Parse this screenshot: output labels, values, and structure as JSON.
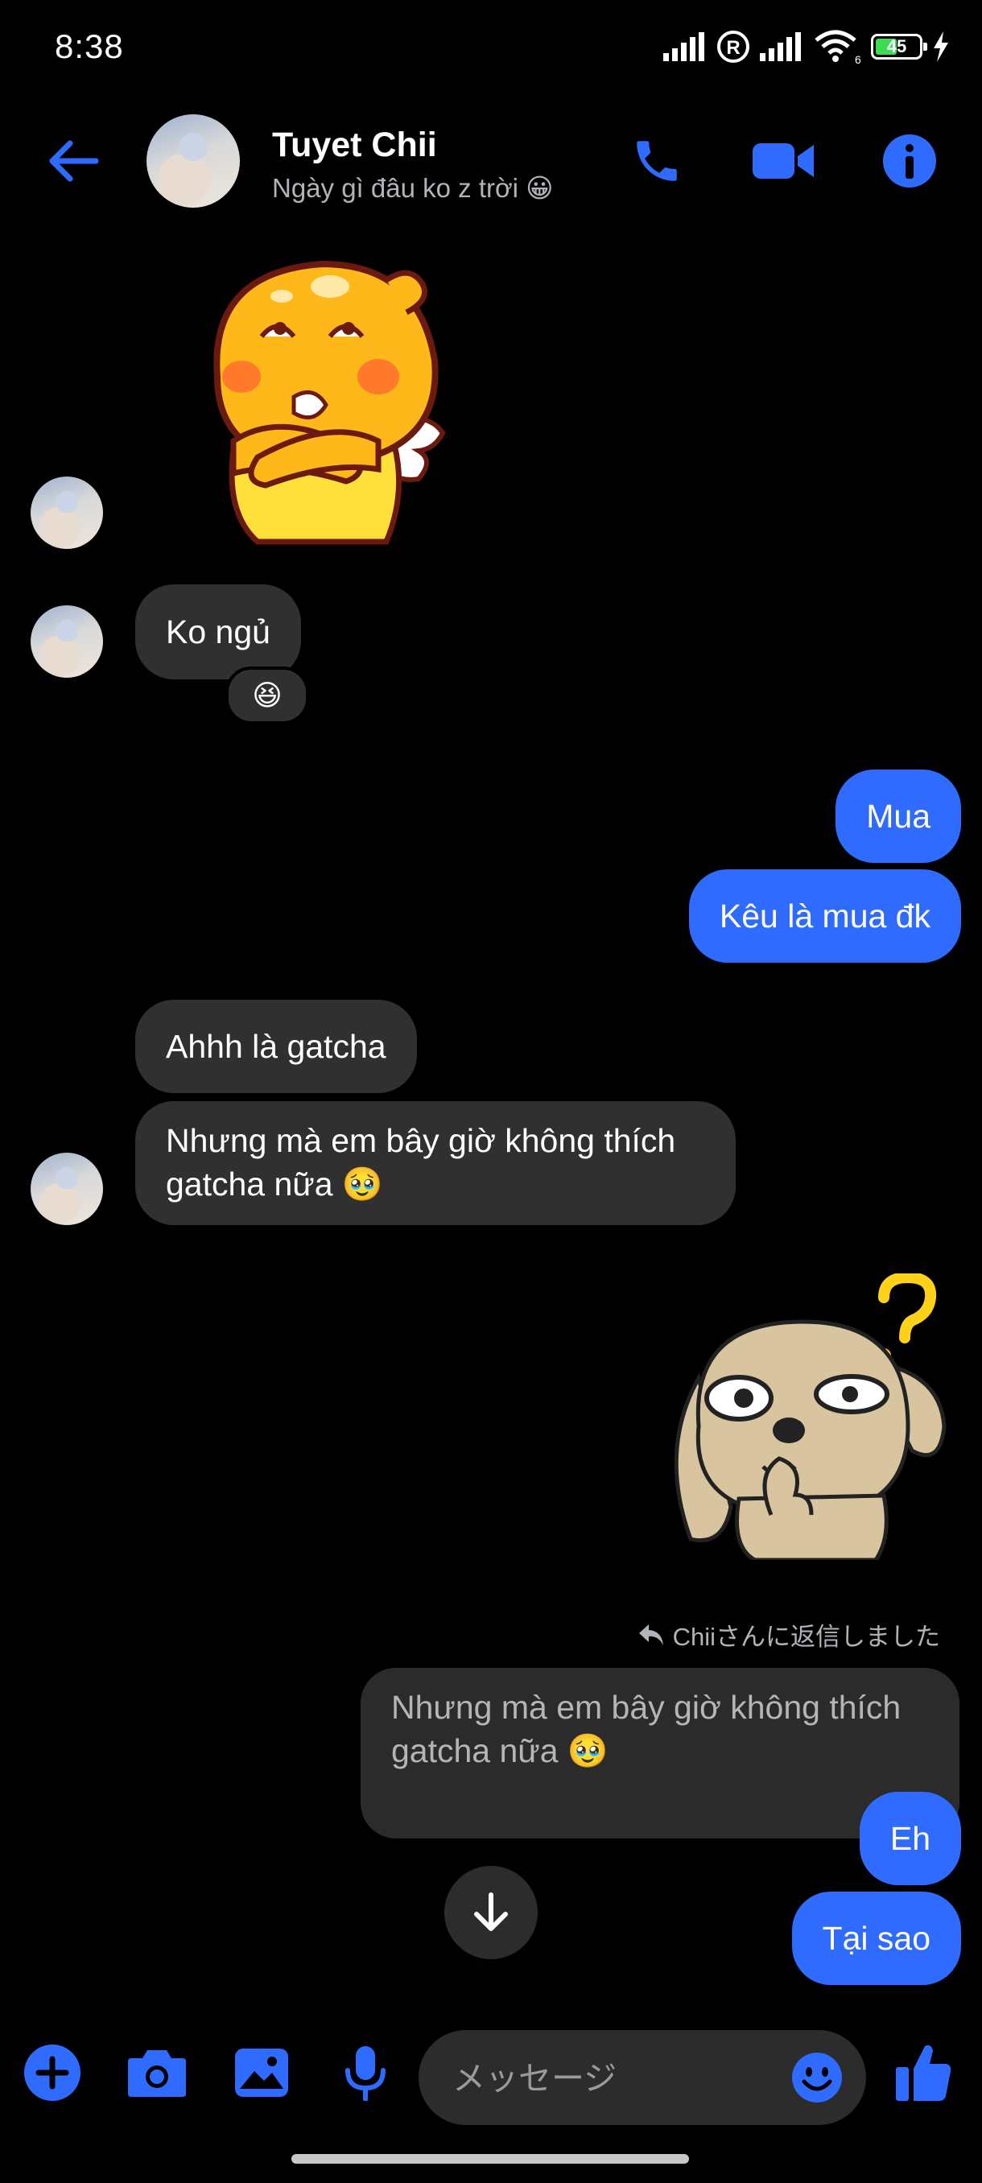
{
  "status_bar": {
    "time": "8:38",
    "battery": "45",
    "network_badge": "6"
  },
  "header": {
    "contact_name": "Tuyet Chii",
    "contact_status": "Ngày gì đâu ko z trời 😀"
  },
  "messages": {
    "m1": "Ko ngủ",
    "m1_reaction": "😆",
    "m2": "Mua",
    "m3": "Kêu là mua đk",
    "m4": "Ahhh là gatcha",
    "m5_line1": "Nhưng mà em bây giờ không thích",
    "m5_line2": "gatcha nữa 🥹",
    "reply_note": "Chiiさんに返信しました",
    "quote_line1": "Nhưng mà em bây giờ không thích",
    "quote_line2": "gatcha nữa 🥹",
    "m6": "Eh",
    "m7": "Tại sao"
  },
  "composer": {
    "placeholder": "メッセージ"
  },
  "colors": {
    "accent": "#2f6bff",
    "incoming_bubble": "#303030",
    "background": "#000000"
  },
  "icons": [
    "back-arrow-icon",
    "phone-icon",
    "video-icon",
    "info-icon",
    "plus-icon",
    "camera-icon",
    "image-icon",
    "mic-icon",
    "emoji-icon",
    "like-icon",
    "arrow-down-icon",
    "reply-icon"
  ]
}
